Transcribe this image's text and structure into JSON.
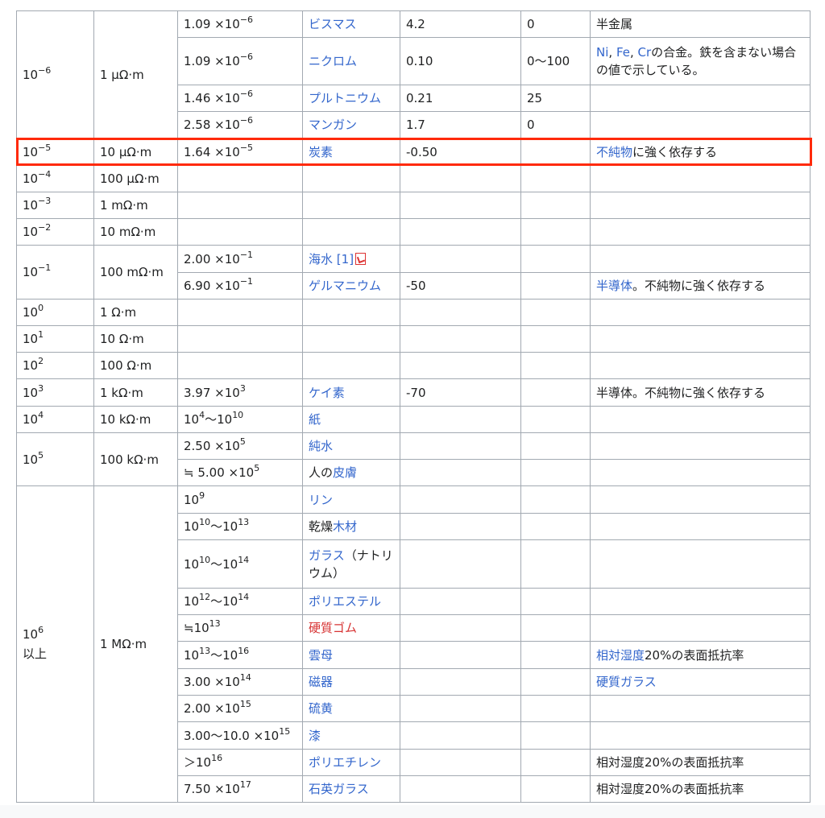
{
  "rows": [
    {
      "order": "10",
      "order_exp": "−6",
      "res": "1 μΩ·m",
      "val": "1.09 ×10",
      "val_exp": "−6",
      "material": "ビスマス",
      "coef": "4.2",
      "temp": "0",
      "note": "半金属"
    },
    {
      "val": "1.09 ×10",
      "val_exp": "−6",
      "material": "ニクロム",
      "coef": "0.10",
      "temp": "0〜100",
      "note_links": [
        "Ni",
        "Fe",
        "Cr"
      ],
      "note_sep": ", ",
      "note_tail": "の合金。鉄を含まない場合の値で示している。"
    },
    {
      "val": "1.46 ×10",
      "val_exp": "−6",
      "material": "プルトニウム",
      "coef": "0.21",
      "temp": "25"
    },
    {
      "val": "2.58 ×10",
      "val_exp": "−6",
      "material": "マンガン",
      "coef": "1.7",
      "temp": "0"
    },
    {
      "order": "10",
      "order_exp": "−5",
      "res": "10 μΩ·m",
      "val": "1.64 ×10",
      "val_exp": "−5",
      "material": "炭素",
      "coef": "-0.50",
      "note_link": "不純物",
      "note_tail": "に強く依存する"
    },
    {
      "order": "10",
      "order_exp": "−4",
      "res": "100 μΩ·m"
    },
    {
      "order": "10",
      "order_exp": "−3",
      "res": "1 mΩ·m"
    },
    {
      "order": "10",
      "order_exp": "−2",
      "res": "10 mΩ·m"
    },
    {
      "order": "10",
      "order_exp": "−1",
      "res": "100 mΩ·m",
      "val": "2.00 ×10",
      "val_exp": "−1",
      "material": "海水",
      "ref": "[1]"
    },
    {
      "val": "6.90 ×10",
      "val_exp": "−1",
      "material": "ゲルマニウム",
      "coef": "-50",
      "note_link": "半導体",
      "note_tail": "。不純物に強く依存する"
    },
    {
      "order": "10",
      "order_exp": "0",
      "res": "1 Ω·m"
    },
    {
      "order": "10",
      "order_exp": "1",
      "res": "10 Ω·m"
    },
    {
      "order": "10",
      "order_exp": "2",
      "res": "100 Ω·m"
    },
    {
      "order": "10",
      "order_exp": "3",
      "res": "1 kΩ·m",
      "val": "3.97 ×10",
      "val_exp": "3",
      "material": "ケイ素",
      "coef": "-70",
      "note": "半導体。不純物に強く依存する"
    },
    {
      "order": "10",
      "order_exp": "4",
      "res": "10 kΩ·m",
      "val_a": "10",
      "val_a_exp": "4",
      "val_b": "〜10",
      "val_b_exp": "10",
      "material": "紙"
    },
    {
      "order": "10",
      "order_exp": "5",
      "res": "100 kΩ·m",
      "val": "2.50 ×10",
      "val_exp": "5",
      "material": "純水"
    },
    {
      "val": "≒ 5.00 ×10",
      "val_exp": "5",
      "material_pre": "人の",
      "material": "皮膚"
    },
    {
      "order": "10",
      "order_exp": "6",
      "order_tail": "以上",
      "res": "1 MΩ·m",
      "val": "10",
      "val_exp": "9",
      "material": "リン"
    },
    {
      "val_a": "10",
      "val_a_exp": "10",
      "val_b": "〜10",
      "val_b_exp": "13",
      "material_pre": "乾燥",
      "material": "木材"
    },
    {
      "val_a": "10",
      "val_a_exp": "10",
      "val_b": "〜10",
      "val_b_exp": "14",
      "material": "ガラス",
      "material_tail": "（ナトリウム）"
    },
    {
      "val_a": "10",
      "val_a_exp": "12",
      "val_b": "〜10",
      "val_b_exp": "14",
      "material": "ポリエステル"
    },
    {
      "val": "≒10",
      "val_exp": "13",
      "material": "硬質ゴム"
    },
    {
      "val_a": "10",
      "val_a_exp": "13",
      "val_b": "〜10",
      "val_b_exp": "16",
      "material": "雲母",
      "note_link": "相対湿度",
      "note_tail": "20%の表面抵抗率"
    },
    {
      "val": "3.00 ×10",
      "val_exp": "14",
      "material": "磁器",
      "note_link": "硬質ガラス"
    },
    {
      "val": "2.00 ×10",
      "val_exp": "15",
      "material": "硫黄"
    },
    {
      "val": "3.00〜10.0 ×10",
      "val_exp": "15",
      "material": "漆"
    },
    {
      "val": "＞10",
      "val_exp": "16",
      "material": "ポリエチレン",
      "note": "相対湿度20%の表面抵抗率"
    },
    {
      "val": "7.50 ×10",
      "val_exp": "17",
      "material": "石英ガラス",
      "note": "相対湿度20%の表面抵抗率"
    }
  ],
  "colors": {
    "link": "#3366cc",
    "redlink": "#d73333",
    "border": "#a2a9b1",
    "highlight": "#ff2a0a"
  }
}
